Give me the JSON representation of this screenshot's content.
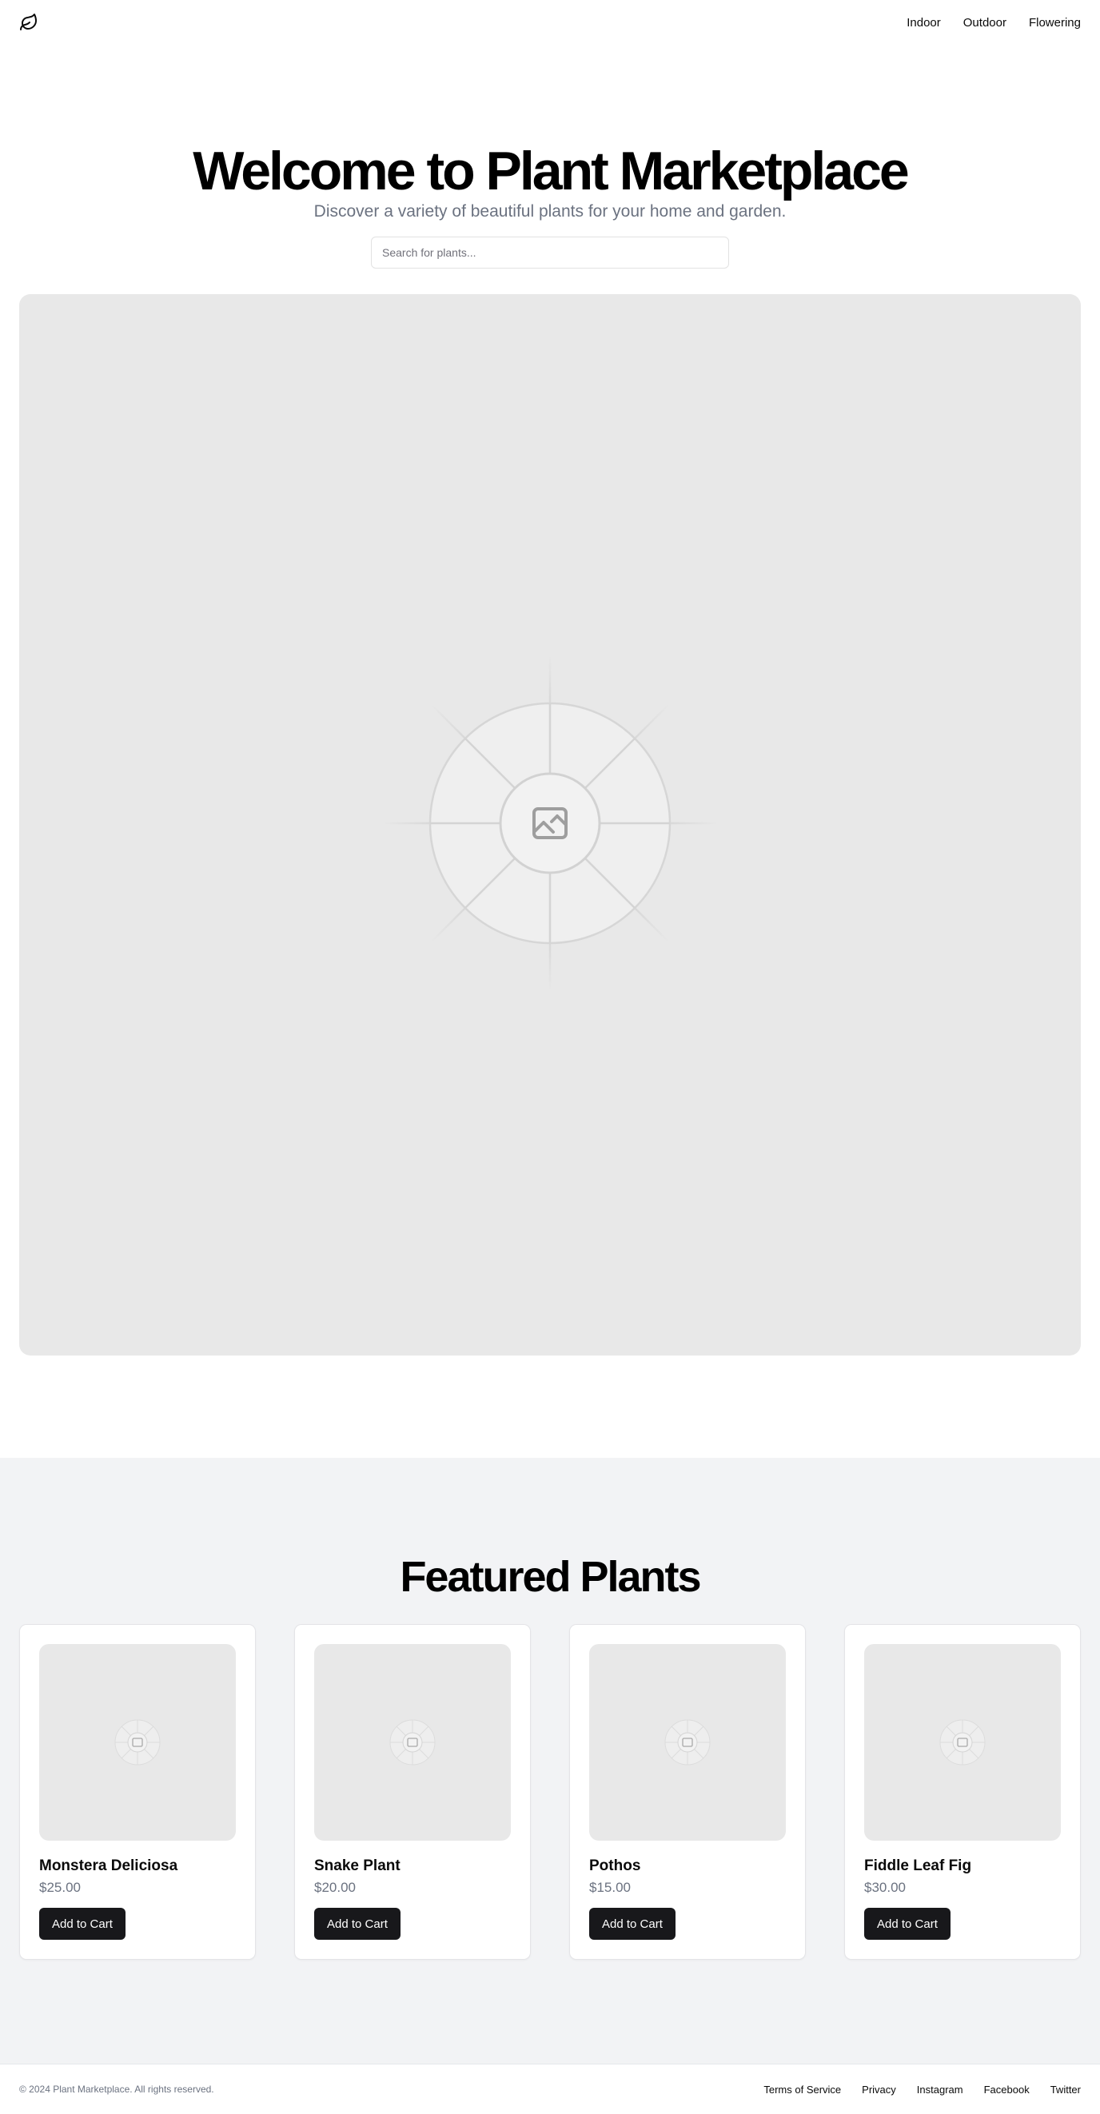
{
  "header": {
    "logo_icon": "leaf-icon",
    "nav": [
      {
        "label": "Indoor"
      },
      {
        "label": "Outdoor"
      },
      {
        "label": "Flowering"
      }
    ]
  },
  "hero": {
    "title": "Welcome to Plant Marketplace",
    "subtitle": "Discover a variety of beautiful plants for your home and garden.",
    "search": {
      "placeholder": "Search for plants...",
      "value": ""
    },
    "image_icon": "image-placeholder-icon"
  },
  "featured": {
    "title": "Featured Plants",
    "products": [
      {
        "name": "Monstera Deliciosa",
        "price": "$25.00",
        "button": "Add to Cart"
      },
      {
        "name": "Snake Plant",
        "price": "$20.00",
        "button": "Add to Cart"
      },
      {
        "name": "Pothos",
        "price": "$15.00",
        "button": "Add to Cart"
      },
      {
        "name": "Fiddle Leaf Fig",
        "price": "$30.00",
        "button": "Add to Cart"
      }
    ]
  },
  "footer": {
    "copyright": "© 2024 Plant Marketplace. All rights reserved.",
    "links": [
      {
        "label": "Terms of Service"
      },
      {
        "label": "Privacy"
      },
      {
        "label": "Instagram"
      },
      {
        "label": "Facebook"
      },
      {
        "label": "Twitter"
      }
    ]
  },
  "colors": {
    "primary_button": "#18181b",
    "muted_text": "#6b7280",
    "section_bg": "#f2f3f5",
    "placeholder_bg": "#e8e8e8"
  }
}
